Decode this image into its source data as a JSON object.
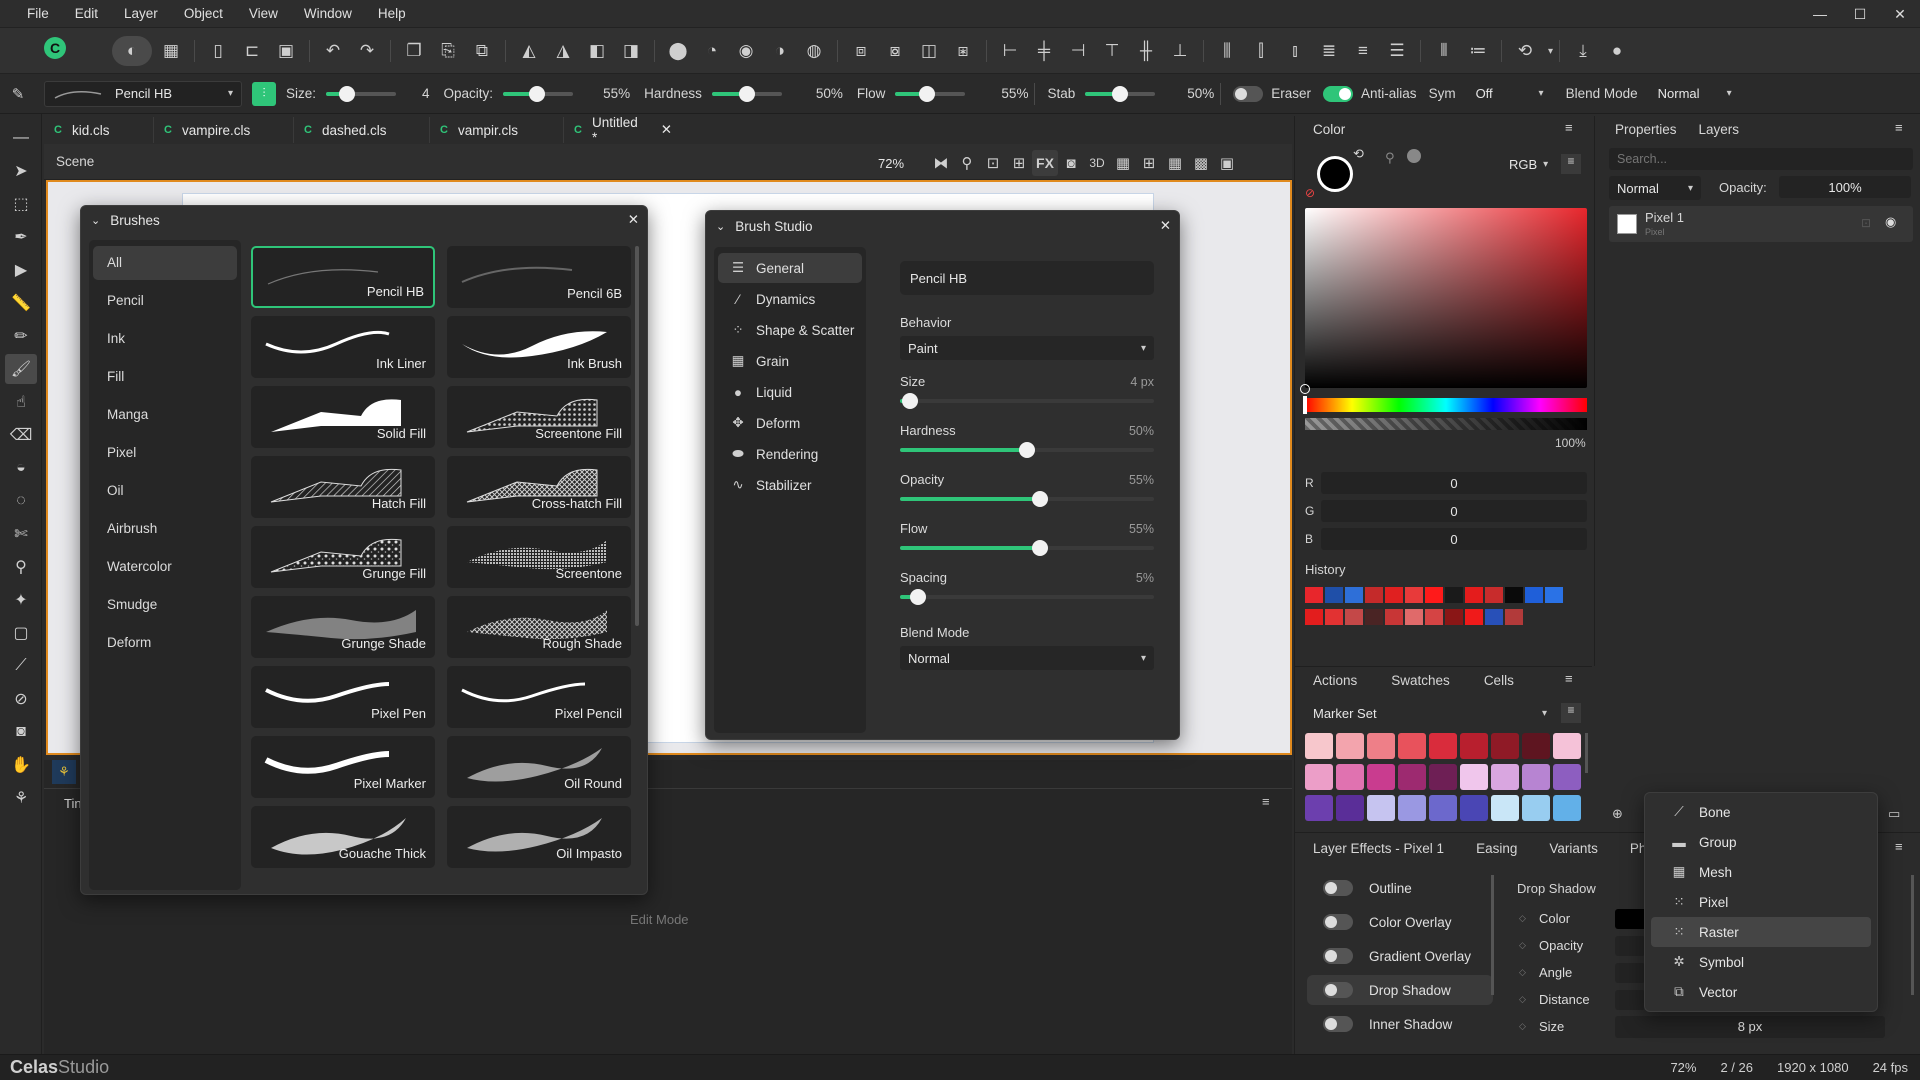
{
  "menu": [
    "File",
    "Edit",
    "Layer",
    "Object",
    "View",
    "Window",
    "Help"
  ],
  "brush_options": {
    "brush_name": "Pencil HB",
    "size_label": "Size:",
    "size_value": "4",
    "opacity_label": "Opacity:",
    "opacity_value": "55%",
    "hardness_label": "Hardness",
    "hardness_value": "50%",
    "flow_label": "Flow",
    "flow_value": "55%",
    "stab_label": "Stab",
    "stab_value": "50%",
    "eraser_label": "Eraser",
    "antialias_label": "Anti-alias",
    "sym_label": "Sym",
    "sym_value": "Off",
    "blend_label": "Blend Mode",
    "blend_value": "Normal"
  },
  "tabs": [
    "kid.cls",
    "vampire.cls",
    "dashed.cls",
    "vampir.cls",
    "Untitled *"
  ],
  "scene": {
    "label": "Scene",
    "zoom": "72%",
    "fx": "FX",
    "three_d": "3D"
  },
  "brushes_panel": {
    "title": "Brushes",
    "categories": [
      "All",
      "Pencil",
      "Ink",
      "Fill",
      "Manga",
      "Pixel",
      "Oil",
      "Airbrush",
      "Watercolor",
      "Smudge",
      "Deform"
    ],
    "items": [
      "Pencil HB",
      "Pencil 6B",
      "Ink Liner",
      "Ink Brush",
      "Solid Fill",
      "Screentone Fill",
      "Hatch Fill",
      "Cross-hatch Fill",
      "Grunge Fill",
      "Screentone",
      "Grunge Shade",
      "Rough Shade",
      "Pixel Pen",
      "Pixel Pencil",
      "Pixel Marker",
      "Oil Round",
      "Gouache Thick",
      "Oil Impasto"
    ]
  },
  "brush_studio": {
    "title": "Brush Studio",
    "nav": [
      "General",
      "Dynamics",
      "Shape & Scatter",
      "Grain",
      "Liquid",
      "Deform",
      "Rendering",
      "Stabilizer"
    ],
    "name": "Pencil HB",
    "behavior_label": "Behavior",
    "behavior_value": "Paint",
    "size_label": "Size",
    "size_value": "4 px",
    "hardness_label": "Hardness",
    "hardness_value": "50%",
    "opacity_label": "Opacity",
    "opacity_value": "55%",
    "flow_label": "Flow",
    "flow_value": "55%",
    "spacing_label": "Spacing",
    "spacing_value": "5%",
    "blend_label": "Blend Mode",
    "blend_value": "Normal"
  },
  "color_panel": {
    "title": "Color",
    "mode": "RGB",
    "alpha": "100%",
    "r_label": "R",
    "r": "0",
    "g_label": "G",
    "g": "0",
    "b_label": "B",
    "b": "0",
    "history_label": "History",
    "history_row1": [
      "#e8262c",
      "#1f4fa8",
      "#2e6fd8",
      "#c42a2a",
      "#e02020",
      "#e83a3a",
      "#ff1a1a",
      "#1a1a1a",
      "#e41c1c",
      "#c82c2c",
      "#0a0a0a",
      "#1f5fd9",
      "#2a72e6"
    ],
    "history_row2": [
      "#e31d1d",
      "#e23232",
      "#c44848",
      "#4a2424",
      "#c83636",
      "#e06a6a",
      "#d54444",
      "#8a1616",
      "#f01a1a",
      "#2850b8",
      "#b23a3a"
    ]
  },
  "layers_panel": {
    "tab_properties": "Properties",
    "tab_layers": "Layers",
    "search_placeholder": "Search...",
    "blend": "Normal",
    "opacity_label": "Opacity:",
    "opacity": "100%",
    "layer_name": "Pixel 1",
    "layer_sub": "Pixel"
  },
  "swatches_panel": {
    "tabs": [
      "Actions",
      "Swatches",
      "Cells"
    ],
    "set": "Marker Set",
    "row1": [
      "#f7c7cc",
      "#f3a4ad",
      "#ee7f88",
      "#e8525c",
      "#d92c3c",
      "#b81f2e",
      "#8f1a26",
      "#5e1520",
      "#f5c2d8"
    ],
    "row2": [
      "#ec9ec8",
      "#e072b0",
      "#c93c8f",
      "#9d2a70",
      "#6e1f55",
      "#f0c6ec",
      "#d9a6e0",
      "#b784d2",
      "#8d5ec0"
    ],
    "row3": [
      "#6c3fae",
      "#5a2e98",
      "#c6c4f0",
      "#9a98e2",
      "#6c68cc",
      "#4a46b4",
      "#c9e6f7",
      "#98cdf0",
      "#62b0e8"
    ]
  },
  "effects_panel": {
    "tabs": [
      "Layer Effects - Pixel 1",
      "Easing",
      "Variants",
      "Phy"
    ],
    "effects": [
      "Outline",
      "Color Overlay",
      "Gradient Overlay",
      "Drop Shadow",
      "Inner Shadow"
    ],
    "detail_title": "Drop Shadow",
    "props": [
      "Color",
      "Opacity",
      "Angle",
      "Distance",
      "Size"
    ],
    "size_value": "8 px"
  },
  "context_menu": [
    "Bone",
    "Group",
    "Mesh",
    "Pixel",
    "Raster",
    "Symbol",
    "Vector"
  ],
  "edit_mode": "Edit Mode",
  "timeline_label": "Tin",
  "status": {
    "brand_a": "Celas",
    "brand_b": "Studio",
    "zoom": "72%",
    "frame": "2 / 26",
    "size": "1920 x 1080",
    "fps": "24 fps"
  },
  "accent": "#2fc579"
}
